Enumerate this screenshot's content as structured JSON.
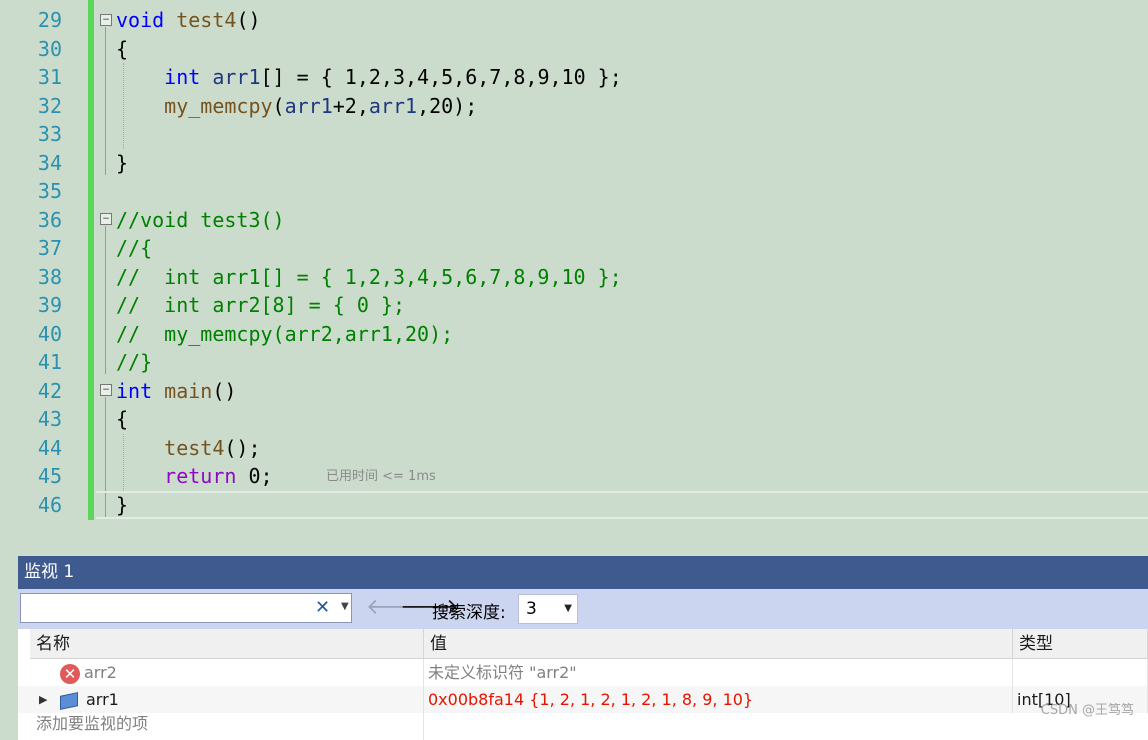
{
  "editor": {
    "line_numbers": [
      "29",
      "30",
      "31",
      "32",
      "33",
      "34",
      "35",
      "36",
      "37",
      "38",
      "39",
      "40",
      "41",
      "42",
      "43",
      "44",
      "45",
      "46"
    ],
    "code": {
      "l29_kw": "void",
      "l29_fn": "test4",
      "l29_rest": "()",
      "l30": "{",
      "l31_kw": "int",
      "l31_var": "arr1",
      "l31_rest": "[] = { 1,2,3,4,5,6,7,8,9,10 };",
      "l32_fn": "my_memcpy",
      "l32_p1": "(",
      "l32_var1": "arr1",
      "l32_p2": "+2,",
      "l32_var2": "arr1",
      "l32_p3": ",20);",
      "l34": "}",
      "l36": "//void test3()",
      "l37": "//{",
      "l38": "//  int arr1[] = { 1,2,3,4,5,6,7,8,9,10 };",
      "l39": "//  int arr2[8] = { 0 };",
      "l40": "//  my_memcpy(arr2,arr1,20);",
      "l41": "//}",
      "l42_kw": "int",
      "l42_fn": "main",
      "l42_rest": "()",
      "l43": "{",
      "l44_fn": "test4",
      "l44_rest": "();",
      "l45_kw": "return",
      "l45_rest": " 0;",
      "l46": "}"
    },
    "elapsed_hint": "已用时间 <= 1ms"
  },
  "watch": {
    "title": "监视 1",
    "search_placeholder": "",
    "depth_label": "搜索深度:",
    "depth_value": "3",
    "columns": {
      "name": "名称",
      "value": "值",
      "type": "类型"
    },
    "rows": [
      {
        "name": "arr2",
        "value": "未定义标识符 \"arr2\"",
        "type": ""
      },
      {
        "name": "arr1",
        "value": "0x00b8fa14 {1, 2, 1, 2, 1, 2, 1, 8, 9, 10}",
        "type": "int[10]"
      }
    ],
    "add_item_hint": "添加要监视的项"
  },
  "watermark": "CSDN @王笃笃",
  "colors": {
    "editor_bg": "#cbdccd",
    "keyword": "#0000ff",
    "function": "#74531f",
    "variable": "#1f377f",
    "comment": "#008000",
    "control_keyword": "#8f08c4",
    "line_number": "#2b91af",
    "change_bar": "#5bd65b",
    "watch_title_bg": "#3e5a8f",
    "error_value": "#e51400"
  },
  "icons": {
    "fold_minus": "minus-box-icon",
    "clear": "close-icon",
    "back": "arrow-left-icon",
    "forward": "arrow-right-icon",
    "error": "error-circle-icon",
    "variable": "variable-cube-icon",
    "refresh": "refresh-icon",
    "expand": "triangle-right-icon"
  }
}
